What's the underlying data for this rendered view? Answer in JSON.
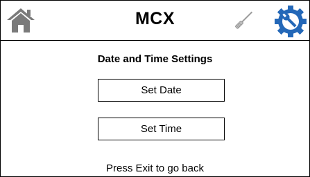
{
  "header": {
    "title": "MCX",
    "home_icon": "home-icon",
    "tool_icon": "screwdriver-icon",
    "settings_icon": "gear-wrench-icon"
  },
  "content": {
    "subtitle": "Date and Time Settings",
    "set_date_label": "Set Date",
    "set_time_label": "Set Time",
    "footer_hint": "Press Exit to go back"
  },
  "colors": {
    "icon_gray": "#7a7a7a",
    "accent_blue": "#2468b8",
    "border": "#000000"
  }
}
